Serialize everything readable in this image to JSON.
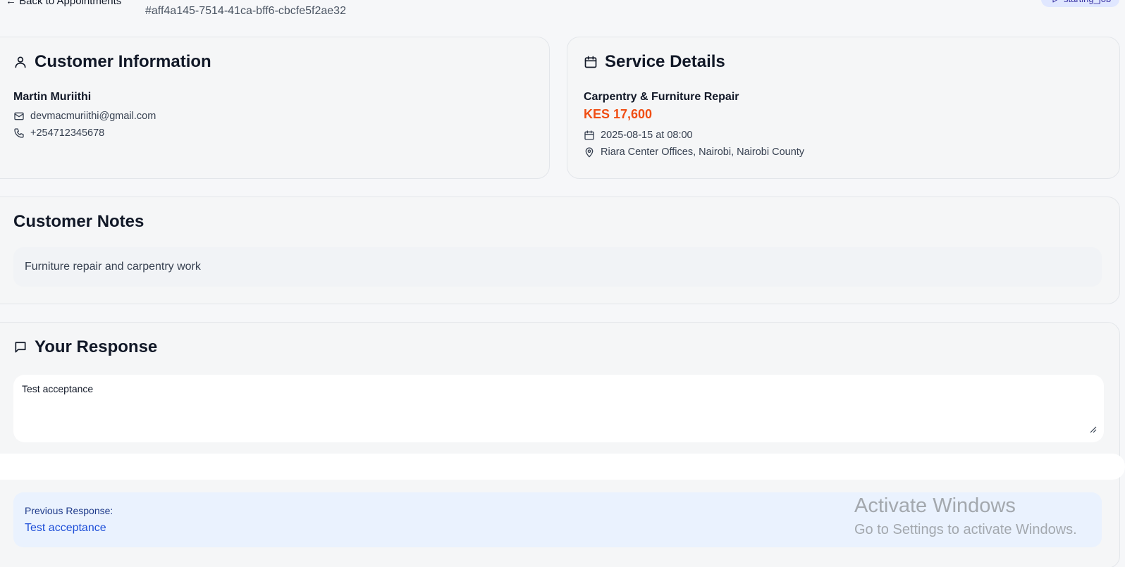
{
  "header": {
    "back_label": "← Back to Appointments",
    "appointment_id": "#aff4a145-7514-41ca-bff6-cbcfe5f2ae32",
    "status": "starting_job"
  },
  "customer": {
    "title": "Customer Information",
    "name": "Martin Muriithi",
    "email": "devmacmuriithi@gmail.com",
    "phone": "+254712345678"
  },
  "service": {
    "title": "Service Details",
    "name": "Carpentry & Furniture Repair",
    "price": "KES 17,600",
    "datetime": "2025-08-15 at 08:00",
    "location": "Riara Center Offices, Nairobi, Nairobi County"
  },
  "notes": {
    "title": "Customer Notes",
    "text": "Furniture repair and carpentry work"
  },
  "response": {
    "title": "Your Response",
    "value": "Test acceptance",
    "previous_label": "Previous Response:",
    "previous_text": "Test acceptance"
  },
  "watermark": {
    "title": "Activate Windows",
    "subtitle": "Go to Settings to activate Windows."
  },
  "colors": {
    "accent_price": "#f04e14",
    "badge_bg": "#e0e7ff",
    "previous_bg": "#eaf2fe"
  }
}
